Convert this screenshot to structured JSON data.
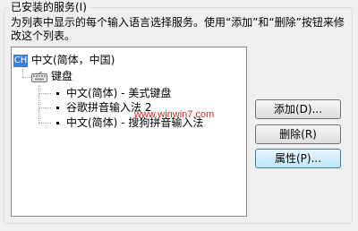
{
  "group": {
    "title": "已安装的服务(I)",
    "description": "为列表中显示的每个输入语言选择服务。使用“添加”和“删除”按钮来修改这个列表。"
  },
  "tree": {
    "language": {
      "badge": "CH",
      "label": "中文(简体，中国)"
    },
    "category": {
      "label": "键盘"
    },
    "items": [
      "中文(简体) - 美式键盘",
      "谷歌拼音输入法 2",
      "中文(简体) - 搜狗拼音输入法"
    ]
  },
  "watermark": "www.winwin7.com",
  "buttons": {
    "add": "添加(D)...",
    "remove": "删除(R)",
    "properties": "属性(P)..."
  }
}
